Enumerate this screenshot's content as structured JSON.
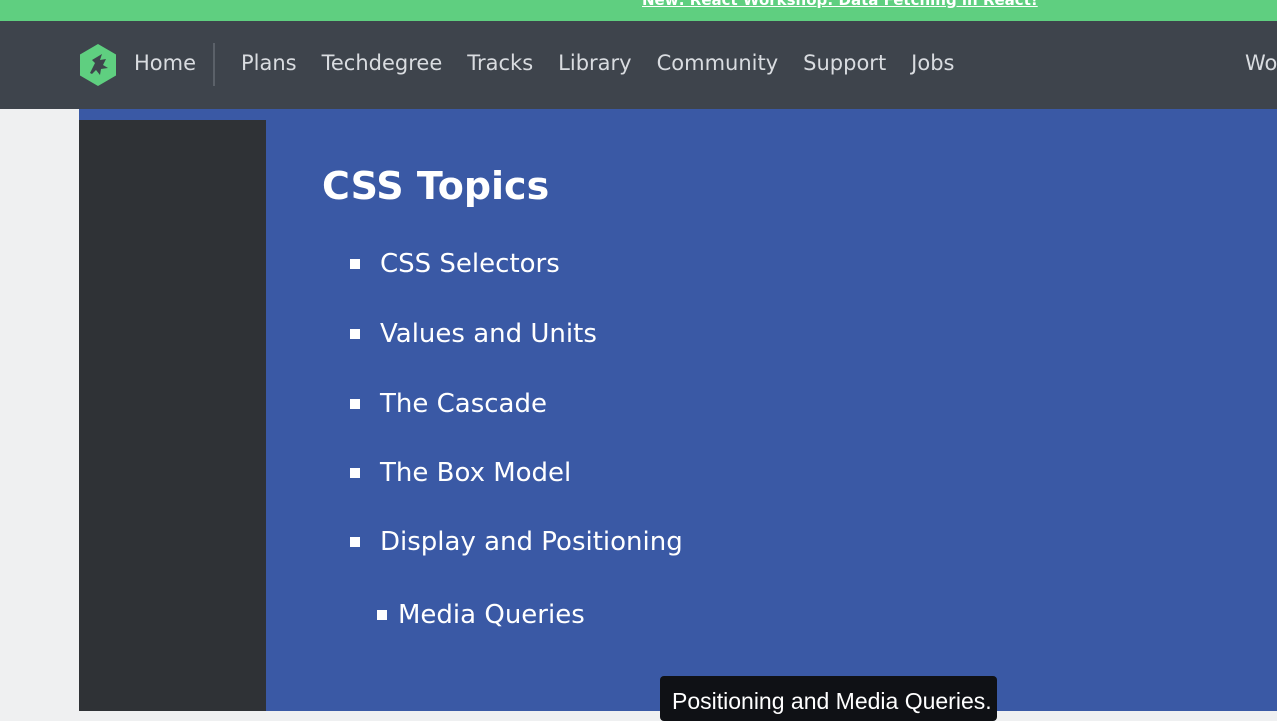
{
  "announcement": {
    "text": "New: React Workshop: Data Fetching in React!"
  },
  "navbar": {
    "logo_icon": "treehouse-logo-icon",
    "home_label": "Home",
    "links": [
      "Plans",
      "Techdegree",
      "Tracks",
      "Library",
      "Community",
      "Support",
      "Jobs"
    ],
    "right_label": "Wo"
  },
  "slide": {
    "title": "CSS Topics",
    "topics": [
      "CSS Selectors",
      "Values and Units",
      "The Cascade",
      "The Box Model",
      "Display and Positioning",
      "Media Queries"
    ]
  },
  "caption": {
    "text": "Positioning and Media Queries."
  },
  "colors": {
    "announce_bg": "#5fcf80",
    "navbar_bg": "#3e444c",
    "slide_bg": "#3a59a5",
    "logo_green": "#5fcf80"
  }
}
